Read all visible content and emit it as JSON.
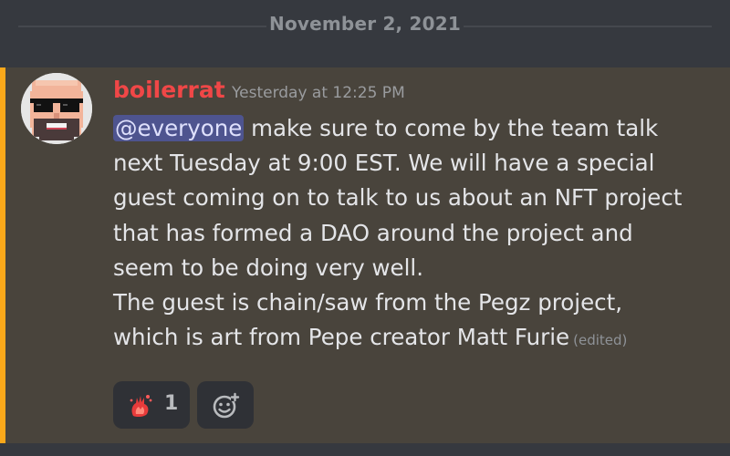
{
  "divider": {
    "date": "November 2, 2021"
  },
  "message": {
    "author": "boilerrat",
    "timestamp": "Yesterday at 12:25 PM",
    "mention": "@everyone",
    "lines": [
      " make sure to come by the team talk",
      "next Tuesday at 9:00 EST. We will have a special",
      "guest coming on to talk to us about an NFT project",
      "that has formed a DAO around the project and",
      "seem to be doing very well.",
      "The guest is chain/saw from the Pegz project,",
      "which is art from Pepe creator Matt Furie"
    ],
    "edited": "(edited)"
  },
  "reactions": [
    {
      "emoji": "fire-hand-emoji",
      "count": "1"
    }
  ],
  "icons": {
    "add_reaction": "add-reaction-icon",
    "avatar": "avatar-sunglasses-pixel"
  },
  "colors": {
    "background": "#36393f",
    "highlight": "#49443c",
    "mention_bar": "#faa81a",
    "author": "#f04747",
    "mention_bg": "#4e548f"
  }
}
